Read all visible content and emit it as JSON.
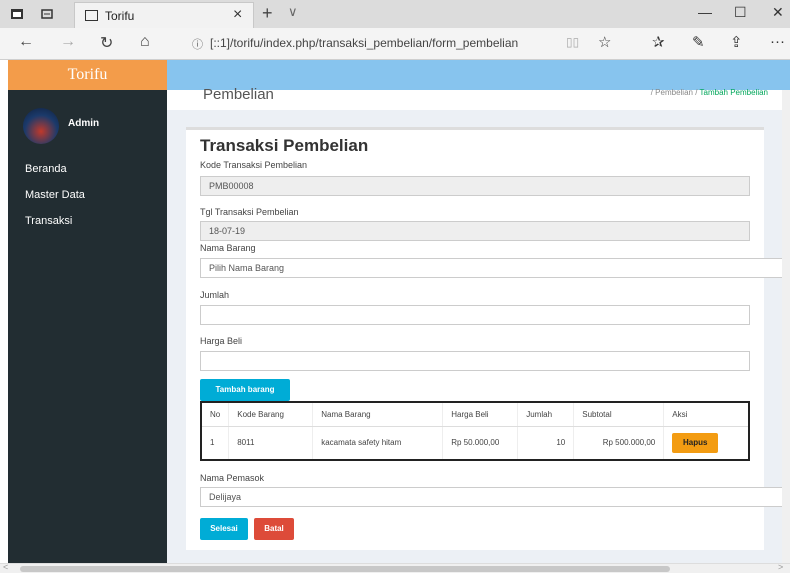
{
  "browser": {
    "tab_title": "Torifu",
    "tab_close": "×",
    "new_tab": "+",
    "tab_menu": "∨",
    "url": "[::1]/torifu/index.php/transaksi_pembelian/form_pembelian",
    "minimize": "—",
    "maximize": "☐",
    "close": "✕",
    "icons": [
      "back-icon",
      "forward-icon",
      "refresh-icon",
      "home-icon",
      "favorite-star-icon",
      "favorites-list-icon",
      "pen-icon",
      "share-icon",
      "more-icon"
    ]
  },
  "sidebar": {
    "brand": "Torifu",
    "user": "Admin",
    "items": [
      {
        "label": "Beranda"
      },
      {
        "label": "Master Data"
      },
      {
        "label": "Transaksi"
      }
    ]
  },
  "page": {
    "title": "Pembelian",
    "breadcrumb": [
      "Pembelian",
      "Tambah Pembelian"
    ]
  },
  "form": {
    "title": "Transaksi Pembelian",
    "kode_label": "Kode Transaksi Pembelian",
    "kode_value": "PMB00008",
    "tgl_label": "Tgl Transaksi Pembelian",
    "tgl_value": "18-07-19",
    "barang_label": "Nama Barang",
    "barang_value": "Pilih Nama Barang",
    "jumlah_label": "Jumlah",
    "jumlah_value": "",
    "harga_label": "Harga Beli",
    "harga_value": "",
    "tambah_button": "Tambah barang",
    "pemasok_label": "Nama Pemasok",
    "pemasok_value": "Delijaya",
    "selesai_button": "Selesai",
    "batal_button": "Batal"
  },
  "table": {
    "headers": [
      "No",
      "Kode Barang",
      "Nama Barang",
      "Harga Beli",
      "Jumlah",
      "Subtotal",
      "Aksi"
    ],
    "rows": [
      {
        "no": "1",
        "kode": "8011",
        "nama": "kacamata safety hitam",
        "harga": "Rp 50.000,00",
        "jumlah": "10",
        "subtotal": "Rp 500.000,00",
        "aksi": "Hapus"
      }
    ]
  },
  "colors": {
    "brand": "#f39c4a",
    "header": "#87c4ee",
    "sidebar": "#222d32",
    "info": "#00acd6",
    "danger": "#dd4b39",
    "warning": "#f39c12"
  }
}
